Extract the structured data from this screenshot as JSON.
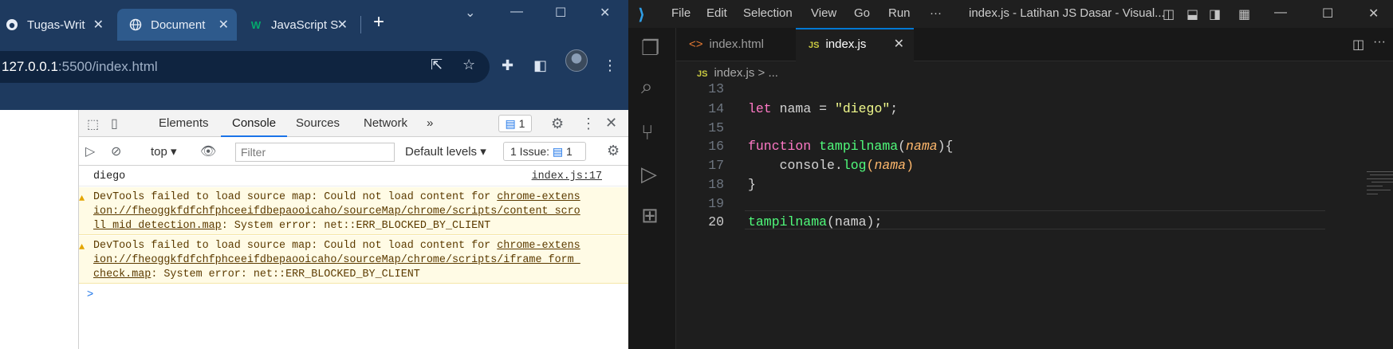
{
  "chrome": {
    "tabs": [
      {
        "label": "Tugas-Writ",
        "icon": "github-icon"
      },
      {
        "label": "Document",
        "icon": "globe-icon"
      },
      {
        "label": "JavaScript S",
        "icon": "w3schools-icon"
      }
    ],
    "url_host": "127.0.0.1",
    "url_path": ":5500/index.html",
    "devtools": {
      "tabs": [
        "Elements",
        "Console",
        "Sources",
        "Network"
      ],
      "more": "»",
      "message_count": "1",
      "context": "top",
      "filter_placeholder": "Filter",
      "levels": "Default levels",
      "issue_label": "1 Issue:",
      "issue_count": "1",
      "log_text": "diego",
      "log_source": "index.js:17",
      "warn1": {
        "prefix": "DevTools failed to load source map: Could not load content for ",
        "link1": "chrome-extens",
        "link2": "ion://fheoggkfdfchfphceeifdbepaooicaho/sourceMap/chrome/scripts/content_scro",
        "link3": "ll_mid_detection.map",
        "suffix": ": System error: net::ERR_BLOCKED_BY_CLIENT"
      },
      "warn2": {
        "prefix": "DevTools failed to load source map: Could not load content for ",
        "link1": "chrome-extens",
        "link2": "ion://fheoggkfdfchfphceeifdbepaooicaho/sourceMap/chrome/scripts/iframe_form_",
        "link3": "check.map",
        "suffix": ": System error: net::ERR_BLOCKED_BY_CLIENT"
      },
      "prompt": ">"
    }
  },
  "vscode": {
    "menu": [
      "File",
      "Edit",
      "Selection",
      "View",
      "Go",
      "Run"
    ],
    "menu_more": "···",
    "window_title": "index.js - Latihan JS Dasar - Visual...",
    "tabs": [
      {
        "label": "index.html",
        "icon": "html-icon"
      },
      {
        "label": "index.js",
        "icon": "js-icon",
        "badge": "JS"
      }
    ],
    "breadcrumb_file": "index.js",
    "breadcrumb_sep": ">",
    "breadcrumb_rest": "...",
    "line_numbers": [
      "13",
      "14",
      "15",
      "16",
      "17",
      "18",
      "19",
      "20"
    ],
    "code": {
      "l14_kw": "let",
      "l14_rest": " nama = ",
      "l14_str": "\"diego\"",
      "l14_end": ";",
      "l16_kw": "function",
      "l16_fn": " tampilnama",
      "l16_open": "(",
      "l16_param": "nama",
      "l16_close": "){",
      "l17_obj": "    console",
      "l17_dot": ".",
      "l17_meth": "log",
      "l17_open": "(",
      "l17_param": "nama",
      "l17_close": ")",
      "l18": "}",
      "l20_fn": "tampilnama",
      "l20_rest": "(nama);"
    },
    "colors": {
      "keyword": "#ff79c6",
      "function": "#50fa7b",
      "string": "#f1fa8c",
      "param": "#ffb86c"
    }
  }
}
